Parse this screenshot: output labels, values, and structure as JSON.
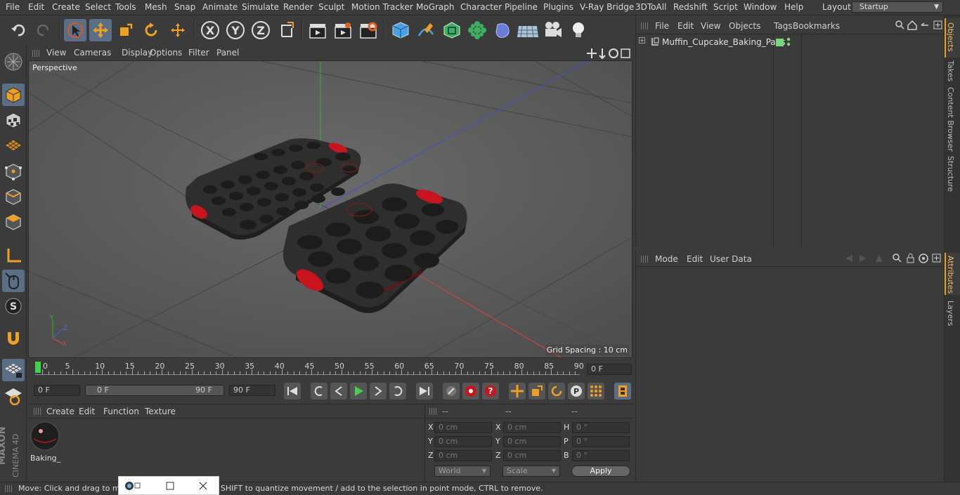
{
  "menu": [
    "File",
    "Edit",
    "Create",
    "Select",
    "Tools",
    "Mesh",
    "Snap",
    "Animate",
    "Simulate",
    "Render",
    "Sculpt",
    "Motion Tracker",
    "MoGraph",
    "Character",
    "Pipeline",
    "Plugins",
    "V-Ray Bridge",
    "3DToAll",
    "Redshift",
    "Script",
    "Window",
    "Help"
  ],
  "layout": {
    "label": "Layout:",
    "value": "Startup"
  },
  "viewport": {
    "menu": [
      "View",
      "Cameras",
      "Display",
      "Options",
      "Filter",
      "Panel"
    ],
    "name": "Perspective",
    "grid_spacing": "Grid Spacing : 10 cm"
  },
  "timeline": {
    "ticks": [
      "0",
      "5",
      "10",
      "15",
      "20",
      "25",
      "30",
      "35",
      "40",
      "45",
      "50",
      "55",
      "60",
      "65",
      "70",
      "75",
      "80",
      "85",
      "90"
    ],
    "current_frame": "0 F"
  },
  "transport": {
    "start": "0 F",
    "range_start": "0 F",
    "range_end": "90 F",
    "end": "90 F"
  },
  "material_manager": {
    "menu": [
      "Create",
      "Edit",
      "Function",
      "Texture"
    ],
    "material_name": "Baking_"
  },
  "coords": {
    "headers": [
      "--",
      "--",
      "--"
    ],
    "rows": [
      {
        "a": "X",
        "av": "0 cm",
        "b": "X",
        "bv": "0 cm",
        "c": "H",
        "cv": "0 °"
      },
      {
        "a": "Y",
        "av": "0 cm",
        "b": "Y",
        "bv": "0 cm",
        "c": "P",
        "cv": "0 °"
      },
      {
        "a": "Z",
        "av": "0 cm",
        "b": "Z",
        "bv": "0 cm",
        "c": "B",
        "cv": "0 °"
      }
    ],
    "world": "World",
    "scale": "Scale",
    "apply": "Apply"
  },
  "object_manager": {
    "menu": [
      "File",
      "Edit",
      "View",
      "Objects",
      "Tags",
      "Bookmarks"
    ],
    "object": "Muffin_Cupcake_Baking_Pans"
  },
  "attribute_manager": {
    "menu": [
      "Mode",
      "Edit",
      "User Data"
    ]
  },
  "right_tabs": [
    "Objects",
    "Takes",
    "Content Browser",
    "Structure",
    "Attributes",
    "Layers"
  ],
  "status": "Move: Click and drag to move elements. Hold down SHIFT to quantize movement / add to the selection in point mode, CTRL to remove.",
  "brand": {
    "maxon": "MAXON",
    "product": "CINEMA 4D"
  },
  "colors": {
    "accent": "#5a6f86",
    "axis_x": "#d84040",
    "axis_y": "#3cae3c",
    "axis_z": "#4050d0",
    "pan": "#2e2e2e",
    "pan_trim": "#c8141e"
  }
}
